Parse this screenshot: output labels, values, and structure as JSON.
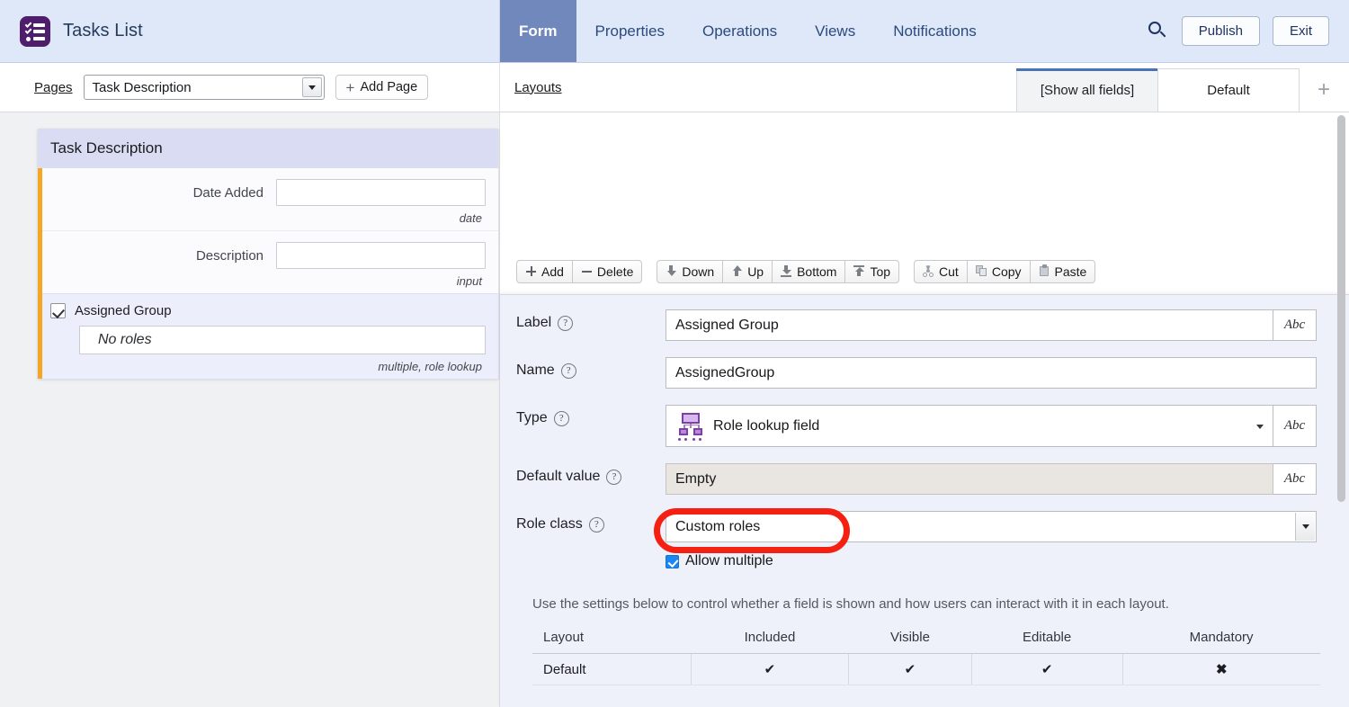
{
  "header": {
    "app_icon": "checklist-icon",
    "title": "Tasks List",
    "tabs": [
      {
        "label": "Form",
        "active": true
      },
      {
        "label": "Properties",
        "active": false
      },
      {
        "label": "Operations",
        "active": false
      },
      {
        "label": "Views",
        "active": false
      },
      {
        "label": "Notifications",
        "active": false
      }
    ],
    "search_icon": "search-icon",
    "publish_label": "Publish",
    "exit_label": "Exit",
    "accent_active_tab": "#7088bb",
    "bar_background": "#dfe8f8"
  },
  "subbar": {
    "pages_label": "Pages",
    "page_select_value": "Task Description",
    "add_page_label": "Add Page",
    "add_page_plus": "+",
    "layouts_label": "Layouts",
    "layout_tabs": [
      {
        "label": "[Show all fields]",
        "active": true
      },
      {
        "label": "Default",
        "active": false
      }
    ],
    "add_layout_plus": "+"
  },
  "canvas": {
    "card_title": "Task Description",
    "accent_color": "#f5a623",
    "fields": [
      {
        "label": "Date Added",
        "value": "",
        "type_hint": "date",
        "selected": false
      },
      {
        "label": "Description",
        "value": "",
        "type_hint": "input",
        "selected": false
      }
    ],
    "selected_field": {
      "checkbox_checked": true,
      "label": "Assigned Group",
      "value": "No roles",
      "type_hint": "multiple, role lookup"
    }
  },
  "toolbar": {
    "groups": [
      [
        {
          "label": "Add",
          "icon": "plus-icon"
        },
        {
          "label": "Delete",
          "icon": "minus-icon"
        }
      ],
      [
        {
          "label": "Down",
          "icon": "arrow-down-icon"
        },
        {
          "label": "Up",
          "icon": "arrow-up-icon"
        },
        {
          "label": "Bottom",
          "icon": "move-to-bottom-icon"
        },
        {
          "label": "Top",
          "icon": "move-to-top-icon"
        }
      ],
      [
        {
          "label": "Cut",
          "icon": "scissors-icon"
        },
        {
          "label": "Copy",
          "icon": "copy-icon"
        },
        {
          "label": "Paste",
          "icon": "paste-icon"
        }
      ]
    ]
  },
  "properties": {
    "help_glyph": "?",
    "abc_glyph": "Abc",
    "label_row": {
      "label": "Label",
      "value": "Assigned Group"
    },
    "name_row": {
      "label": "Name",
      "value": "AssignedGroup"
    },
    "type_row": {
      "label": "Type",
      "value": "Role lookup field",
      "icon": "org-chart-icon"
    },
    "default_row": {
      "label": "Default value",
      "value": "Empty"
    },
    "role_class_row": {
      "label": "Role class",
      "value": "Custom roles",
      "highlight_color": "#f42112"
    },
    "allow_multiple": {
      "label": "Allow multiple",
      "checked": true,
      "color": "#1c86f2"
    },
    "hint": "Use the settings below to control whether a field is shown and how users can interact with it in each layout.",
    "table": {
      "columns": [
        "Layout",
        "Included",
        "Visible",
        "Editable",
        "Mandatory"
      ],
      "rows": [
        {
          "layout": "Default",
          "included": "✔",
          "visible": "✔",
          "editable": "✔",
          "mandatory": "✖"
        }
      ]
    }
  }
}
